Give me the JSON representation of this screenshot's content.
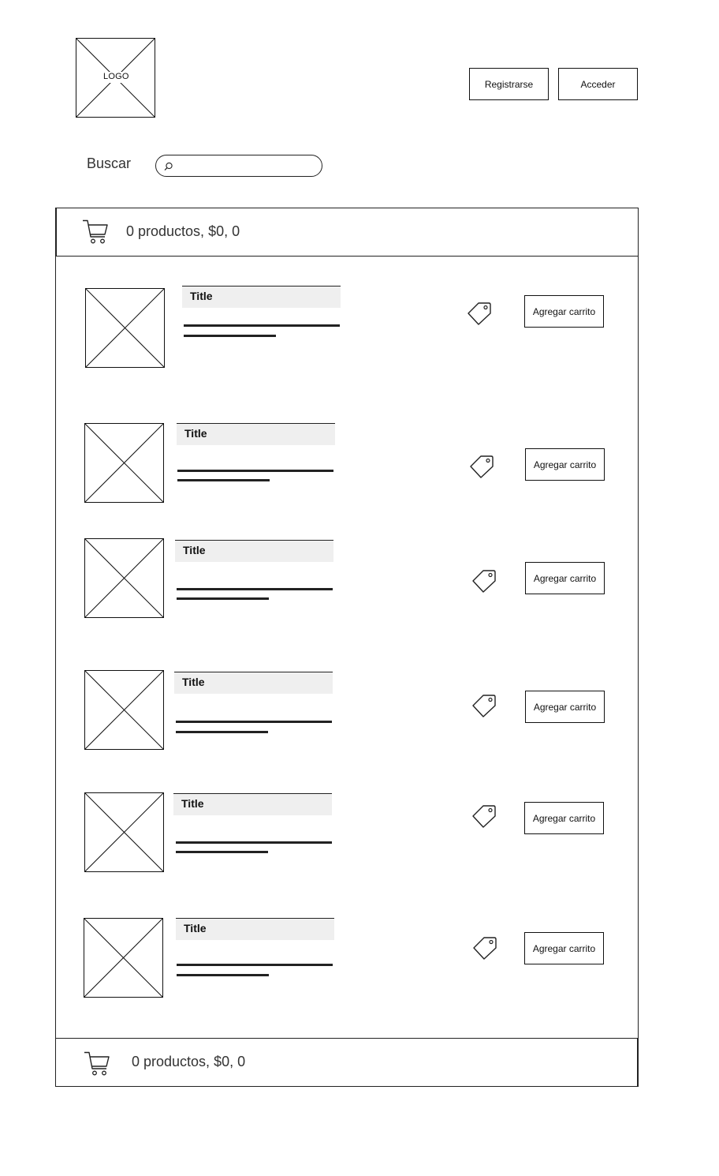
{
  "header": {
    "logo_text": "LOGO",
    "register_label": "Registrarse",
    "login_label": "Acceder"
  },
  "search": {
    "label": "Buscar",
    "value": "",
    "placeholder": ""
  },
  "cart_summary_top": "0 productos, $0, 0",
  "cart_summary_bottom": "0 productos, $0, 0",
  "products": [
    {
      "title": "Title",
      "button_label": "Agregar carrito"
    },
    {
      "title": "Title",
      "button_label": "Agregar carrito"
    },
    {
      "title": "Title",
      "button_label": "Agregar carrito"
    },
    {
      "title": "Title",
      "button_label": "Agregar carrito"
    },
    {
      "title": "Title",
      "button_label": "Agregar carrito"
    },
    {
      "title": "Title",
      "button_label": "Agregar carrito"
    }
  ],
  "icons": {
    "cart": "shopping-cart-icon",
    "price": "price-tag-icon",
    "search": "search-icon",
    "image": "image-placeholder-icon"
  }
}
